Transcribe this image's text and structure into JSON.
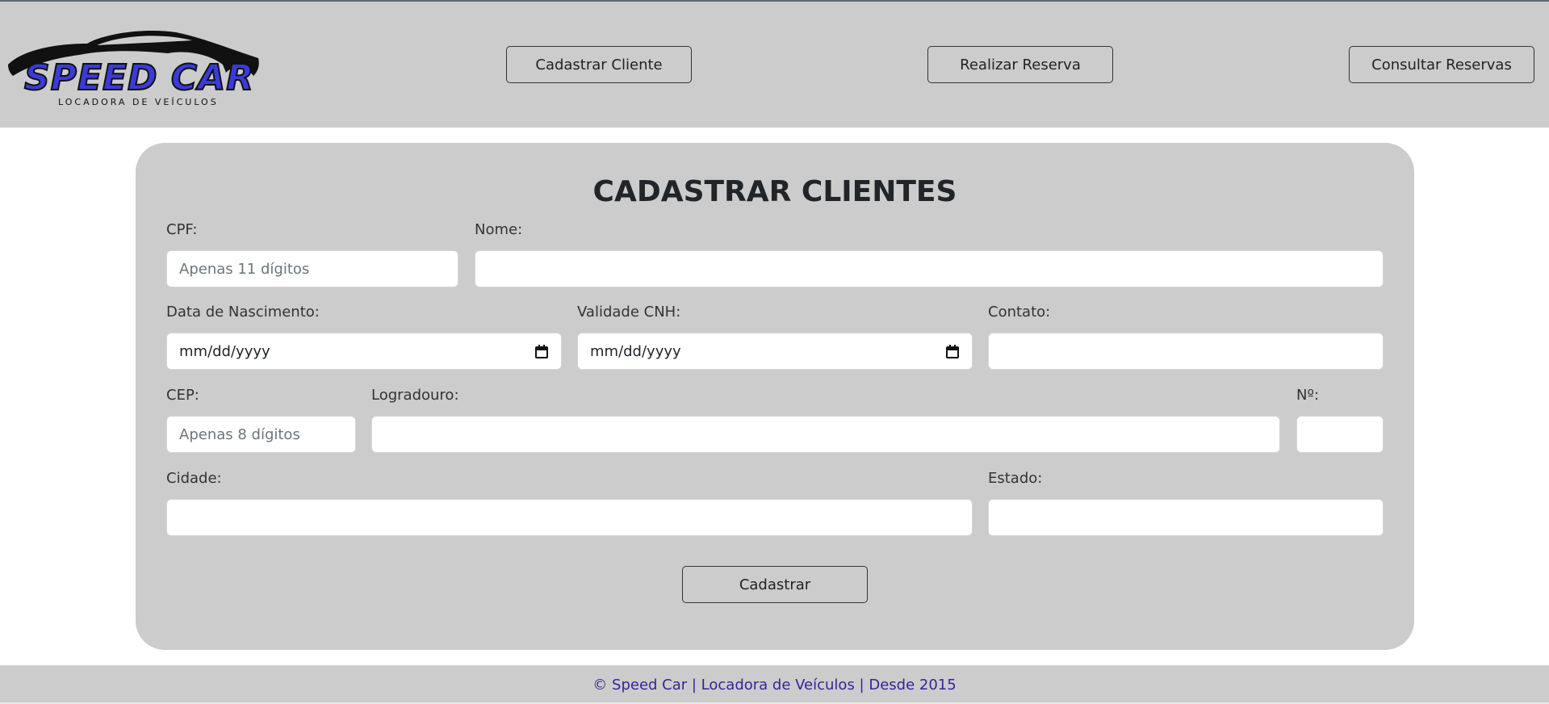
{
  "brand": {
    "name": "SPEED CAR",
    "tagline": "LOCADORA DE VEÍCULOS"
  },
  "nav": {
    "cadastrar_cliente": "Cadastrar Cliente",
    "realizar_reserva": "Realizar Reserva",
    "consultar_reservas": "Consultar Reservas"
  },
  "form": {
    "title": "CADASTRAR CLIENTES",
    "fields": {
      "cpf": {
        "label": "CPF:",
        "placeholder": "Apenas 11 dígitos",
        "value": ""
      },
      "nome": {
        "label": "Nome:",
        "value": ""
      },
      "data_nascimento": {
        "label": "Data de Nascimento:",
        "value": "mm/dd/yyyy"
      },
      "validade_cnh": {
        "label": "Validade CNH:",
        "value": "mm/dd/yyyy"
      },
      "contato": {
        "label": "Contato:",
        "value": ""
      },
      "cep": {
        "label": "CEP:",
        "placeholder": "Apenas 8 dígitos",
        "value": ""
      },
      "logradouro": {
        "label": "Logradouro:",
        "value": ""
      },
      "numero": {
        "label": "Nº:",
        "value": ""
      },
      "cidade": {
        "label": "Cidade:",
        "value": ""
      },
      "estado": {
        "label": "Estado:",
        "value": ""
      }
    },
    "submit_label": "Cadastrar"
  },
  "footer": {
    "text": "© Speed Car | Locadora de Veículos | Desde 2015"
  },
  "colors": {
    "header_bg": "#cccccc",
    "card_bg": "#cccccc",
    "footer_text": "#3a1f9a",
    "logo_accent": "#3b3ad9"
  },
  "icons": {
    "calendar": "calendar-icon",
    "car": "car-silhouette-icon"
  }
}
